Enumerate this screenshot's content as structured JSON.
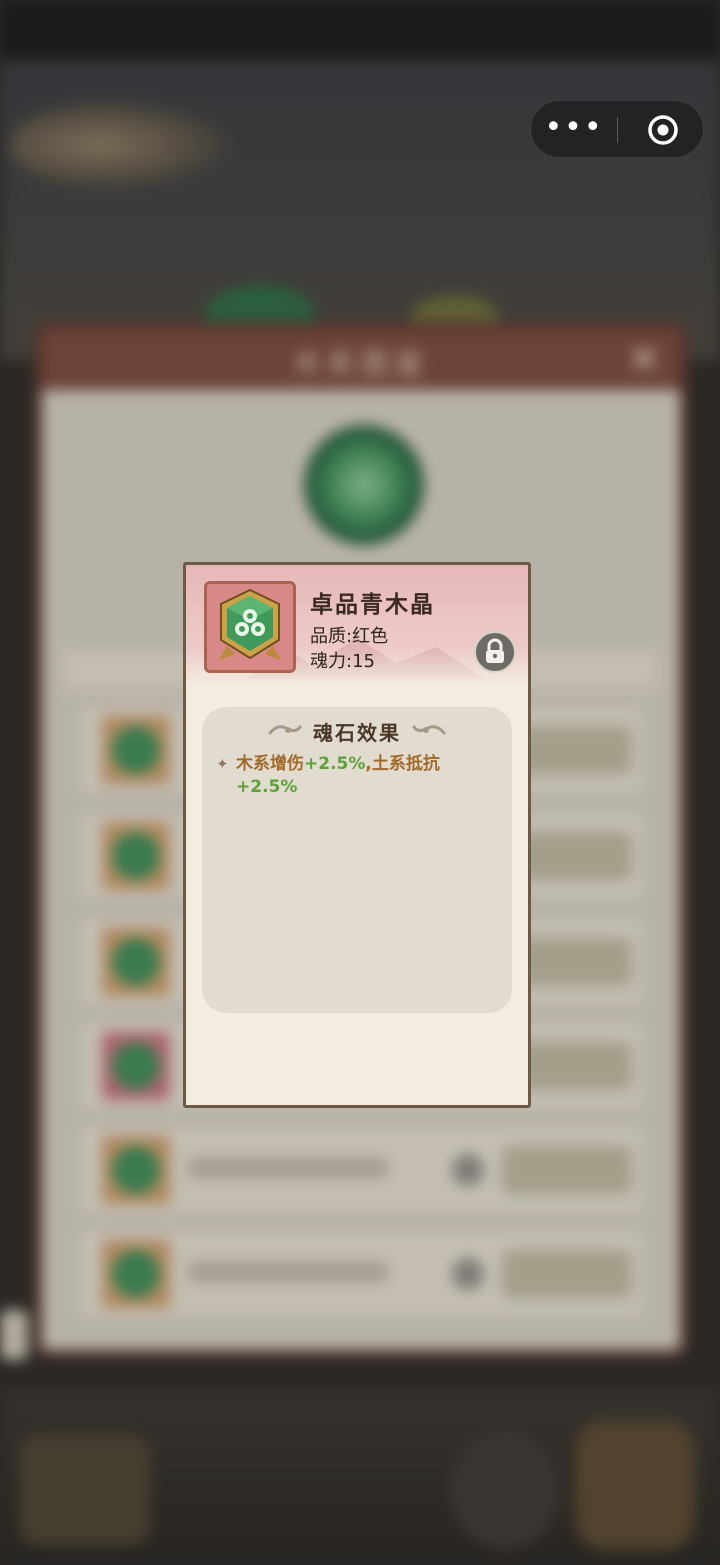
{
  "background": {
    "panel_title": "木系图鉴"
  },
  "capsule": {
    "more_label": "•••",
    "more_icon": "more-dots-icon",
    "close_icon": "target-circle-icon"
  },
  "item": {
    "name": "卓品青木晶",
    "quality": "品质:红色",
    "soul_power": "魂力:15",
    "icon": "green-clover-gem-icon",
    "lock_icon": "lock-icon"
  },
  "effect": {
    "title": "魂石效果",
    "bullet": "✦",
    "text_1": "木系增伤",
    "value_1": "+2.5%",
    "sep": ",",
    "text_2": "土系抵抗",
    "value_2": "+2.5%"
  },
  "colors": {
    "card_header": "#e7b8b8",
    "card_body": "#f3ede0",
    "effect_text": "#a06a2a",
    "effect_value": "#5ea13a"
  }
}
